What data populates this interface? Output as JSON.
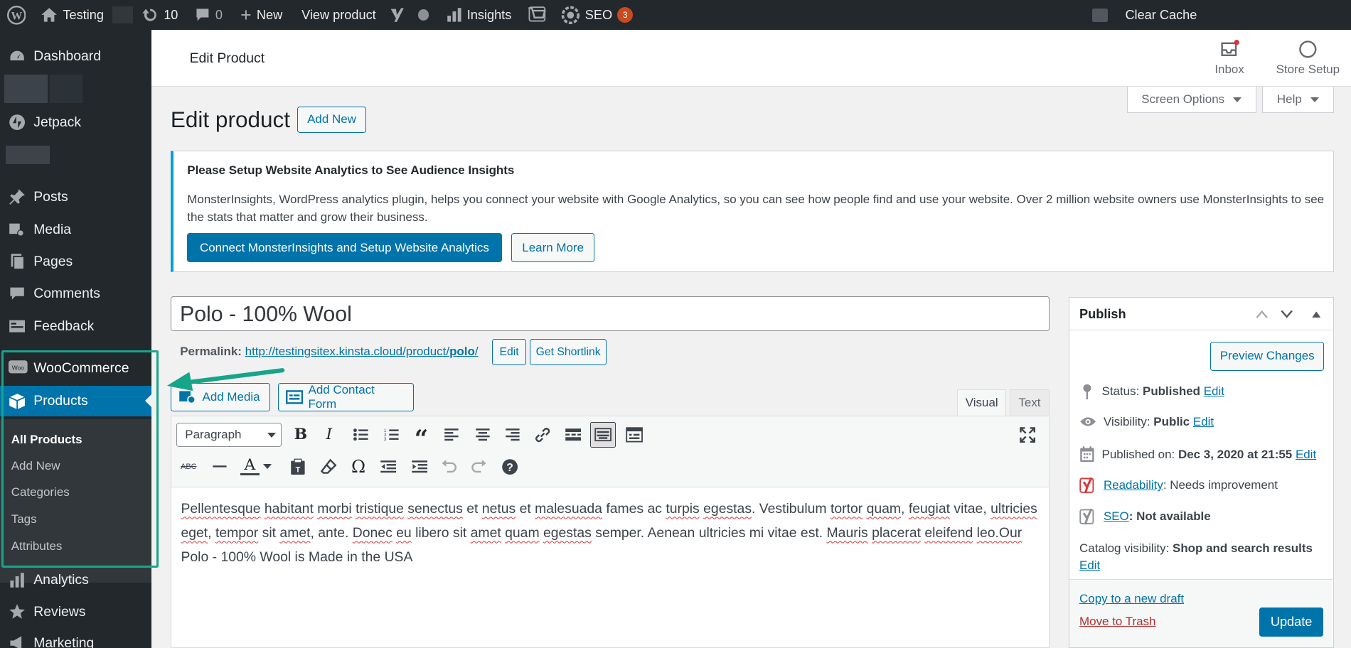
{
  "admin_bar": {
    "site_name": "Testing",
    "updates_count": "10",
    "comments_count": "0",
    "new_label": "New",
    "view_product": "View product",
    "insights": "Insights",
    "seo": "SEO",
    "seo_badge": "3",
    "clear_cache": "Clear Cache"
  },
  "sidebar": {
    "items": [
      {
        "label": "Dashboard",
        "icon": "dashboard-icon"
      },
      {
        "label": "Jetpack",
        "icon": "jetpack-icon"
      },
      {
        "label": "Posts",
        "icon": "pushpin-icon"
      },
      {
        "label": "Media",
        "icon": "media-icon"
      },
      {
        "label": "Pages",
        "icon": "pages-icon"
      },
      {
        "label": "Comments",
        "icon": "comment-icon"
      },
      {
        "label": "Feedback",
        "icon": "feedback-icon"
      },
      {
        "label": "WooCommerce",
        "icon": "woo-icon"
      },
      {
        "label": "Products",
        "icon": "box-icon"
      },
      {
        "label": "Analytics",
        "icon": "bar-chart-icon"
      },
      {
        "label": "Reviews",
        "icon": "star-icon"
      },
      {
        "label": "Marketing",
        "icon": "megaphone-icon"
      }
    ],
    "submenu": [
      "All Products",
      "Add New",
      "Categories",
      "Tags",
      "Attributes"
    ]
  },
  "header": {
    "title": "Edit Product",
    "inbox": "Inbox",
    "store_setup": "Store Setup",
    "screen_options": "Screen Options",
    "help": "Help"
  },
  "page": {
    "heading": "Edit product",
    "add_new": "Add New"
  },
  "notice": {
    "title": "Please Setup Website Analytics to See Audience Insights",
    "body": "MonsterInsights, WordPress analytics plugin, helps you connect your website with Google Analytics, so you can see how people find and use your website. Over 2 million website owners use MonsterInsights to see the stats that matter and grow their business.",
    "connect_button": "Connect MonsterInsights and Setup Website Analytics",
    "learn_more": "Learn More"
  },
  "product": {
    "title": "Polo - 100% Wool",
    "permalink_label": "Permalink:",
    "permalink_base": "http://testingsitex.kinsta.cloud/product/",
    "permalink_slug": "polo",
    "permalink_end": "/",
    "edit_button": "Edit",
    "shortlink_button": "Get Shortlink"
  },
  "editor": {
    "add_media": "Add Media",
    "add_contact_form": "Add Contact Form",
    "tab_visual": "Visual",
    "tab_text": "Text",
    "format_select": "Paragraph",
    "content_words": [
      "Pellentesque",
      "habitant",
      "morbi",
      "tristique",
      "senectus",
      "et",
      "netus",
      "et",
      "malesuada",
      "fames ac",
      "turpis",
      "egestas",
      ". Vestibulum",
      "tortor",
      "quam",
      ",",
      "feugiat",
      "vitae,",
      "ultricies",
      "eget",
      ",",
      "tempor",
      "sit",
      "amet",
      ", ante.",
      "Donec",
      "eu",
      "libero sit",
      "amet",
      "quam",
      "egestas",
      "semper.",
      "Aenean",
      "ultricies",
      "mi vitae est.",
      "Mauris",
      "placerat",
      "eleifend",
      "leo.Our",
      " Polo - 100% Wool is Made in the USA"
    ]
  },
  "publish": {
    "title": "Publish",
    "preview_changes": "Preview Changes",
    "status_label": "Status:",
    "status_value": "Published",
    "visibility_label": "Visibility:",
    "visibility_value": "Public",
    "published_label": "Published on:",
    "published_value": "Dec 3, 2020 at 21:55",
    "readability_link": "Readability",
    "readability_value": ": Needs improvement",
    "seo_link": "SEO",
    "seo_value": ": Not available",
    "catalog_label": "Catalog visibility:",
    "catalog_value": "Shop and search results",
    "edit_link": "Edit",
    "copy_draft": "Copy to a new draft",
    "move_trash": "Move to Trash",
    "update": "Update"
  },
  "colors": {
    "admin_dark": "#23282d",
    "wp_blue": "#0073aa",
    "highlight_green": "#17a589",
    "notice_accent": "#00a0d2"
  }
}
